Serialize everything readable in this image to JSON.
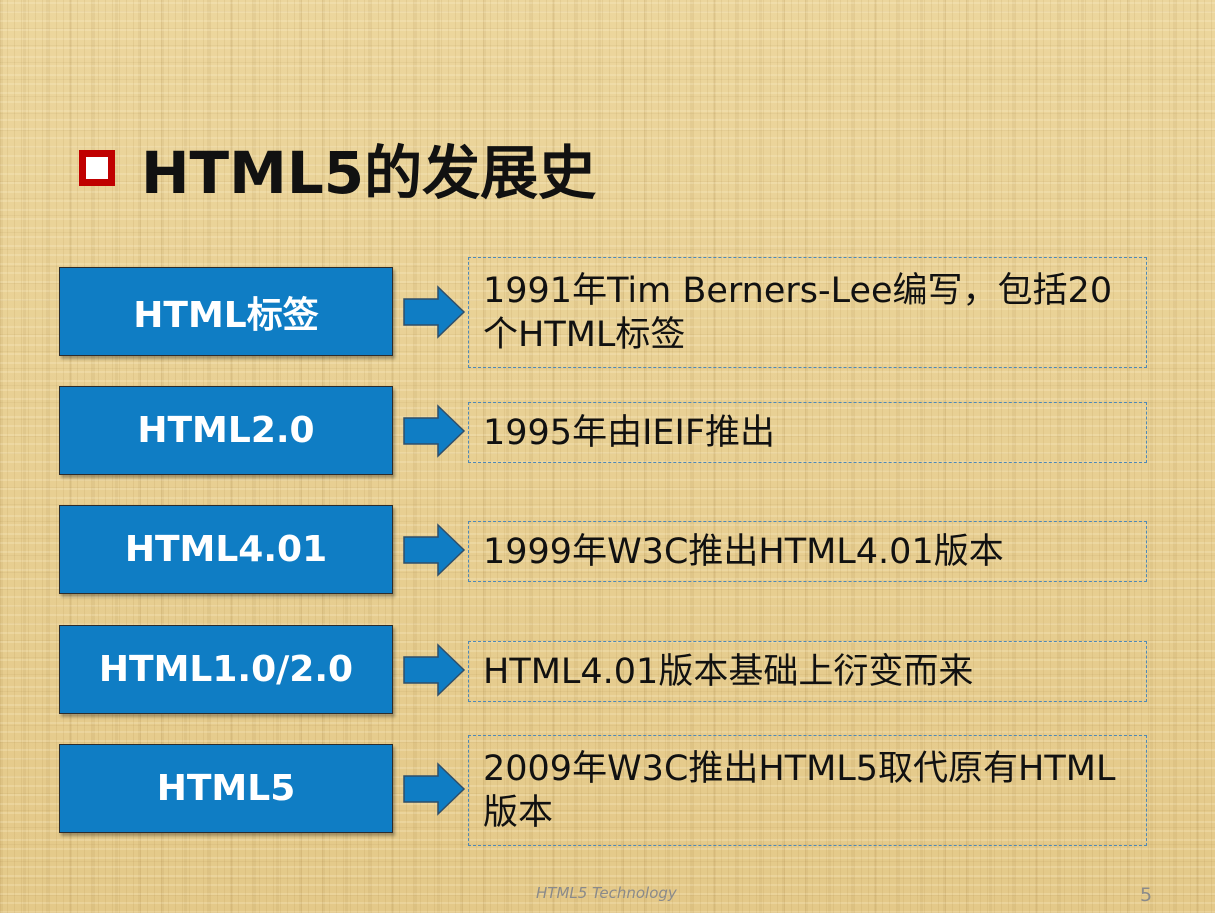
{
  "slide": {
    "title": "HTML5的发展史",
    "accent_color": "#c00000",
    "box_color": "#0f7dc4",
    "footer": "HTML5 Technology",
    "page_number": "5"
  },
  "timeline": [
    {
      "label": "HTML标签",
      "description": "1991年Tim Berners-Lee编写，包括20个HTML标签"
    },
    {
      "label": "HTML2.0",
      "description": "1995年由IEIF推出"
    },
    {
      "label": "HTML4.01",
      "description": "1999年W3C推出HTML4.01版本"
    },
    {
      "label": "HTML1.0/2.0",
      "description": "HTML4.01版本基础上衍变而来"
    },
    {
      "label": "HTML5",
      "description": "2009年W3C推出HTML5取代原有HTML版本"
    }
  ]
}
